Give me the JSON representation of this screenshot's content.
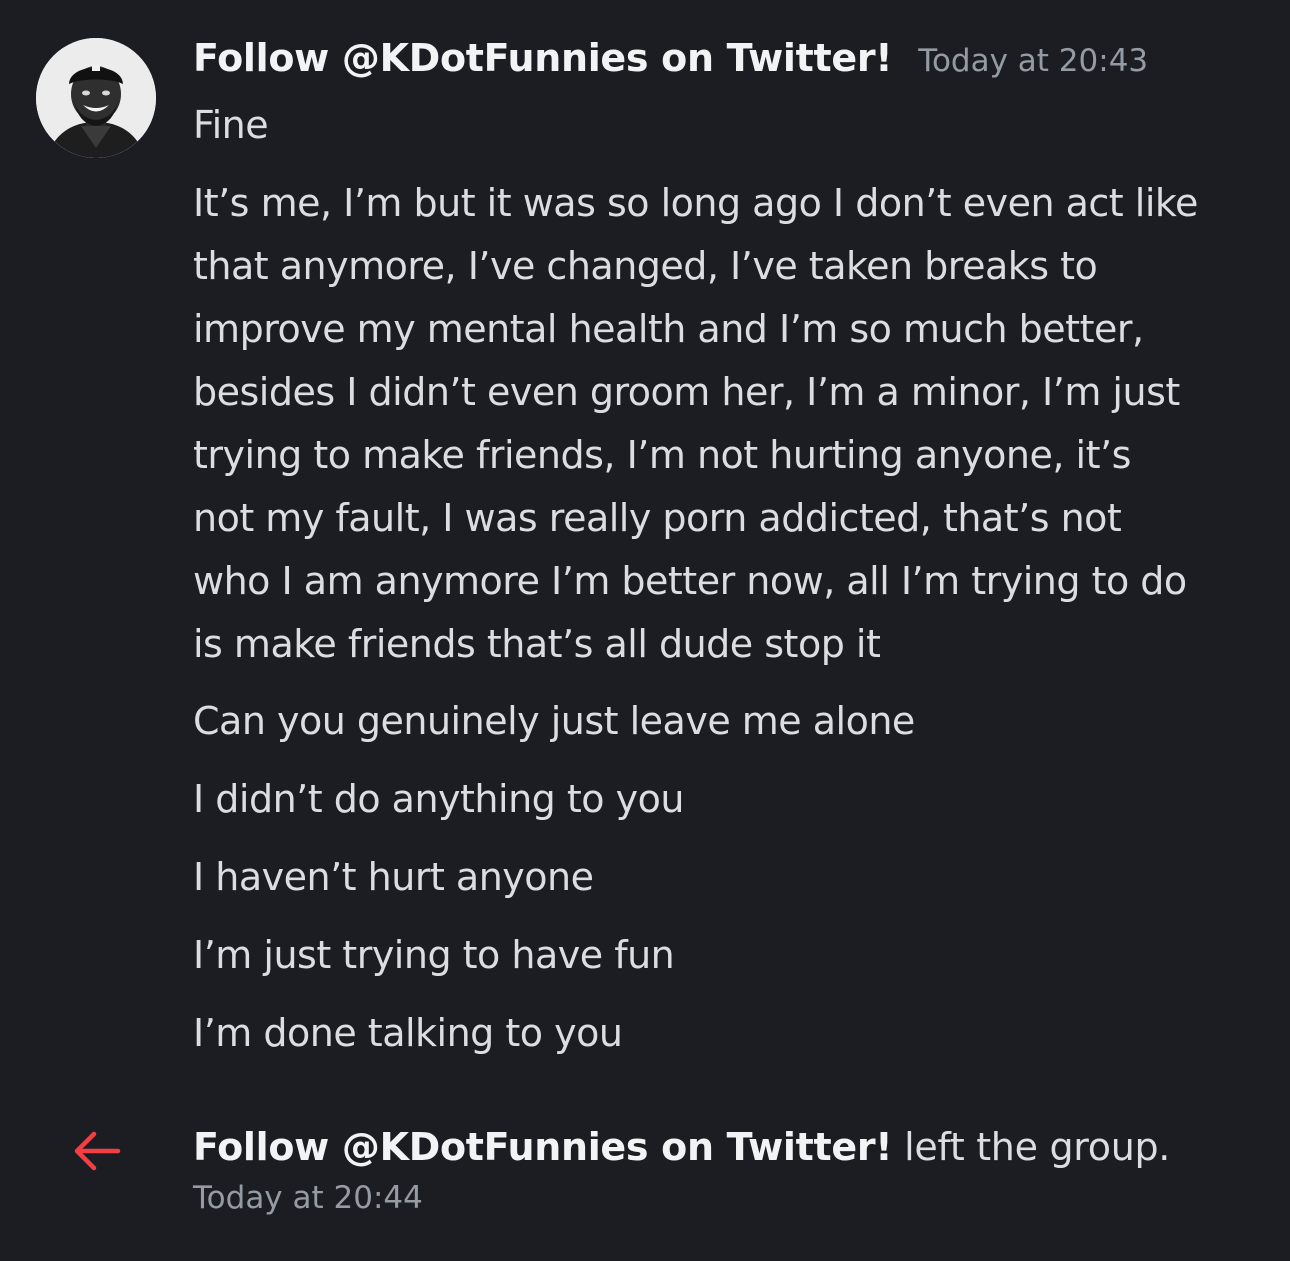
{
  "message": {
    "author": "Follow @KDotFunnies on Twitter!",
    "timestamp": "Today at 20:43",
    "avatar_icon": "user-avatar-icon",
    "lines": {
      "fine": "Fine",
      "paragraph": [
        "It’s me, I’m but it was so long ago I don’t even act like",
        "that anymore, I’ve changed, I’ve taken breaks to",
        "improve my mental health and I’m so much better,",
        "besides I didn’t even groom her, I’m a minor, I’m just",
        "trying to make friends, I’m not hurting anyone, it’s",
        "not my fault, I was really porn addicted, that’s not",
        "who I am anymore I’m better now, all I’m trying to do",
        "is make friends that’s all dude stop it"
      ],
      "leave_alone": "Can you genuinely just leave me alone",
      "didnt_do": "I didn’t do anything to you",
      "havent_hurt": "I haven’t hurt anyone",
      "have_fun": "I’m just trying to have fun",
      "done_talking": "I’m done talking to you"
    }
  },
  "system_message": {
    "icon": "left-arrow-icon",
    "icon_color": "#f23f43",
    "author": "Follow @KDotFunnies on Twitter!",
    "text": " left the group.",
    "timestamp": "Today at 20:44"
  },
  "colors": {
    "background": "#1c1d23",
    "author": "#f2f3f5",
    "body_text": "#dbdee1",
    "muted": "#949ba4"
  }
}
